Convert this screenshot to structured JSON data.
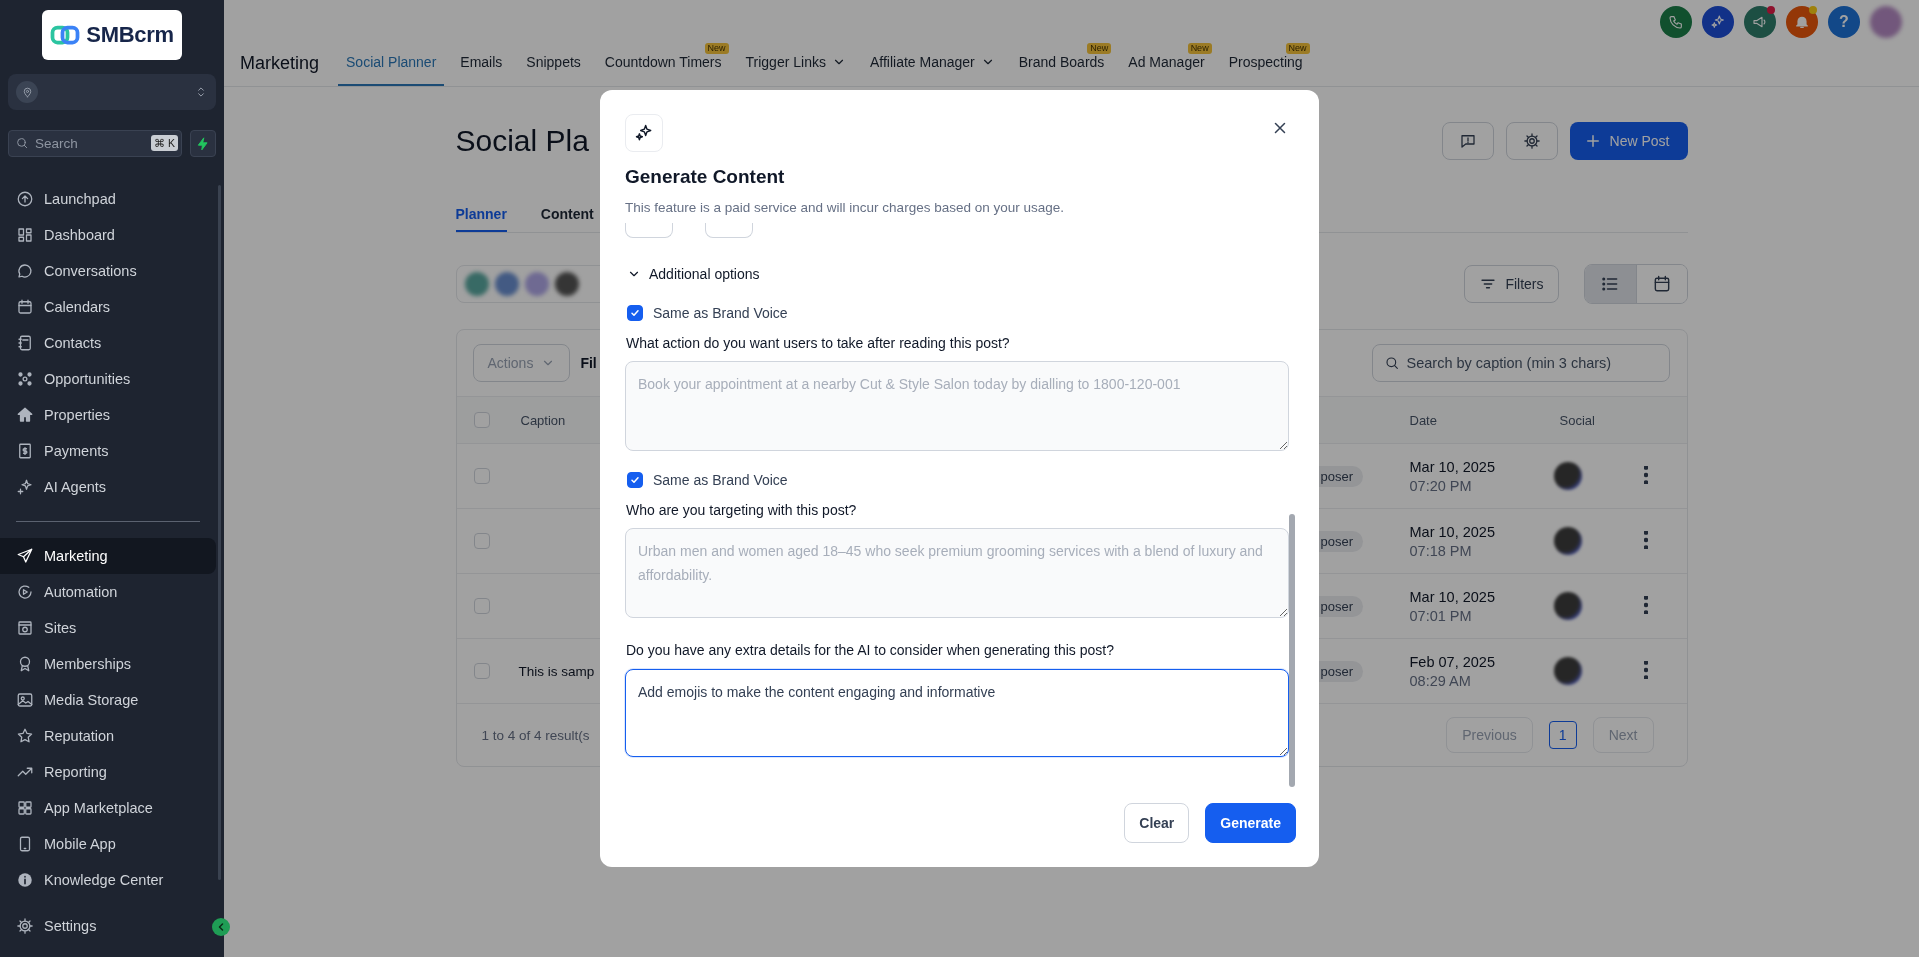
{
  "sidebar": {
    "logo": {
      "text": "SMBcrm"
    },
    "search": {
      "placeholder": "Search",
      "shortcut": "⌘ K"
    },
    "sections": [
      [
        {
          "label": "Launchpad",
          "selected": false
        },
        {
          "label": "Dashboard",
          "selected": false
        },
        {
          "label": "Conversations",
          "selected": false
        },
        {
          "label": "Calendars",
          "selected": false
        },
        {
          "label": "Contacts",
          "selected": false
        },
        {
          "label": "Opportunities",
          "selected": false
        },
        {
          "label": "Properties",
          "selected": false
        },
        {
          "label": "Payments",
          "selected": false
        },
        {
          "label": "AI Agents",
          "selected": false
        }
      ],
      [
        {
          "label": "Marketing",
          "selected": true
        },
        {
          "label": "Automation",
          "selected": false
        },
        {
          "label": "Sites",
          "selected": false
        },
        {
          "label": "Memberships",
          "selected": false
        },
        {
          "label": "Media Storage",
          "selected": false
        },
        {
          "label": "Reputation",
          "selected": false
        },
        {
          "label": "Reporting",
          "selected": false
        },
        {
          "label": "App Marketplace",
          "selected": false
        },
        {
          "label": "Mobile App",
          "selected": false
        },
        {
          "label": "Knowledge Center",
          "selected": false
        }
      ]
    ],
    "footer_items": [
      {
        "label": "Settings",
        "selected": false
      }
    ]
  },
  "header": {
    "title": "Marketing",
    "tabs": [
      {
        "label": "Social Planner",
        "selected": true
      },
      {
        "label": "Emails",
        "selected": false
      },
      {
        "label": "Snippets",
        "selected": false
      },
      {
        "label": "Countdown Timers",
        "selected": false,
        "badge": "New"
      },
      {
        "label": "Trigger Links",
        "selected": false,
        "dropdown": true
      },
      {
        "label": "Affiliate Manager",
        "selected": false,
        "dropdown": true
      },
      {
        "label": "Brand Boards",
        "selected": false,
        "badge": "New"
      },
      {
        "label": "Ad Manager",
        "selected": false,
        "badge": "New"
      },
      {
        "label": "Prospecting",
        "selected": false,
        "badge": "New"
      }
    ],
    "actions": [
      {
        "kind": "phone"
      },
      {
        "kind": "ai"
      },
      {
        "kind": "announcements",
        "unread": true
      },
      {
        "kind": "notifications",
        "unread": true
      },
      {
        "kind": "help",
        "label": "?"
      },
      {
        "kind": "avatar"
      }
    ]
  },
  "page": {
    "title": "Social Pla",
    "new_post_button": "New Post",
    "tabs": [
      {
        "label": "Planner",
        "selected": true
      },
      {
        "label": "Content",
        "selected": false
      }
    ],
    "filters_button": "Filters",
    "views": [
      {
        "kind": "list",
        "selected": true
      },
      {
        "kind": "calendar",
        "selected": false
      }
    ],
    "table": {
      "actions_button": {
        "label": "Actions",
        "disabled": true
      },
      "filter_label": "Fil",
      "search_placeholder": "Search by caption (min 3 chars)",
      "select_all": {
        "checked": false
      },
      "columns": [
        "Caption",
        "Date",
        "Social"
      ],
      "rows": [
        {
          "checked": false,
          "column_3": "poser",
          "date": "Mar 10, 2025",
          "time": "07:20 PM"
        },
        {
          "checked": false,
          "column_3": "poser",
          "date": "Mar 10, 2025",
          "time": "07:18 PM"
        },
        {
          "checked": false,
          "column_3": "poser",
          "date": "Mar 10, 2025",
          "time": "07:01 PM"
        },
        {
          "checked": false,
          "caption": "This is samp",
          "column_3": "poser",
          "date": "Feb 07, 2025",
          "time": "08:29 AM"
        }
      ],
      "pagination": {
        "summary": "1 to 4 of 4 result(s",
        "previous": {
          "label": "Previous",
          "disabled": true
        },
        "pages": [
          {
            "label": "1",
            "selected": true
          }
        ],
        "next": {
          "label": "Next",
          "disabled": true
        }
      }
    }
  },
  "modal": {
    "title": "Generate Content",
    "subtitle": "This feature is a paid service and will incur charges based on your usage.",
    "additional_options": {
      "label": "Additional options",
      "expanded": true
    },
    "questions": [
      {
        "brand_voice": {
          "label": "Same as Brand Voice",
          "checked": true
        },
        "label": "What action do you want users to take after reading this post?",
        "placeholder": "Book your appointment at a nearby Cut & Style Salon today by dialling to 1800-120-001",
        "focused": false
      },
      {
        "brand_voice": {
          "label": "Same as Brand Voice",
          "checked": true
        },
        "label": "Who are you targeting with this post?",
        "placeholder": "Urban men and women aged 18–45 who seek premium grooming services with a blend of luxury and affordability.",
        "focused": false
      },
      {
        "label": "Do you have any extra details for the AI to consider when generating this post?",
        "value": "Add emojis to make the content engaging and informative",
        "focused": true
      }
    ],
    "buttons": [
      {
        "kind": "secondary",
        "label": "Clear"
      },
      {
        "kind": "primary",
        "label": "Generate"
      }
    ]
  }
}
